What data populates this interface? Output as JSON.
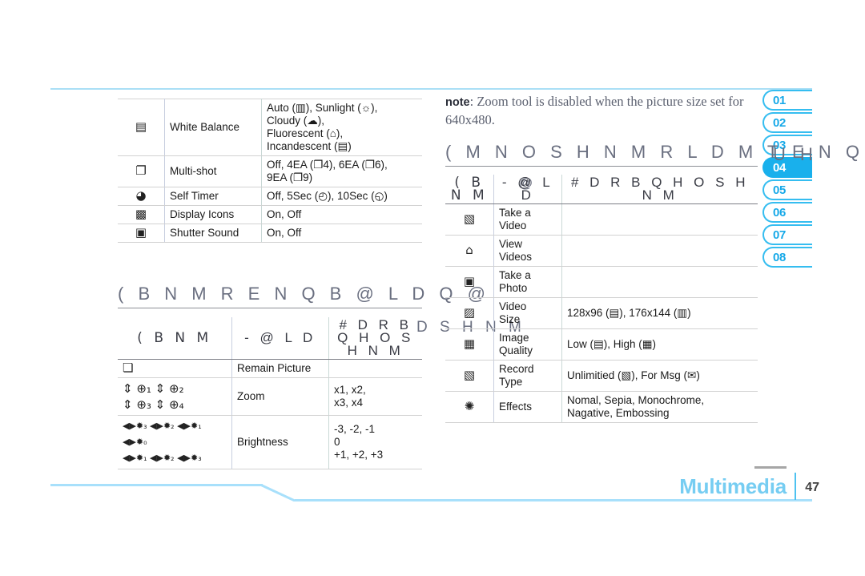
{
  "page": {
    "footer_title": "Multimedia",
    "footer_page_number": "47"
  },
  "tab_rail": {
    "items": [
      {
        "label": "01",
        "active": false
      },
      {
        "label": "02",
        "active": false
      },
      {
        "label": "03",
        "active": false
      },
      {
        "label": "04",
        "active": true
      },
      {
        "label": "05",
        "active": false
      },
      {
        "label": "06",
        "active": false
      },
      {
        "label": "07",
        "active": false
      },
      {
        "label": "08",
        "active": false
      }
    ]
  },
  "camera_settings_table": {
    "rows": [
      {
        "icon": "white-balance-icon",
        "icon_glyph": "▤",
        "name": "White Balance",
        "description": "Auto (▥), Sunlight (☼),\nCloudy (☁),\nFluorescent (⌂),\nIncandescent (▤)"
      },
      {
        "icon": "multi-shot-icon",
        "icon_glyph": "❐",
        "name": "Multi-shot",
        "description": "Off, 4EA (❐4), 6EA (❐6),\n9EA (❐9)"
      },
      {
        "icon": "self-timer-icon",
        "icon_glyph": "◕",
        "name": "Self Timer",
        "description": "Off, 5Sec (◴), 10Sec (◵)"
      },
      {
        "icon": "display-icons-icon",
        "icon_glyph": "▩",
        "name": "Display Icons",
        "description": "On, Off"
      },
      {
        "icon": "shutter-sound-icon",
        "icon_glyph": "▣",
        "name": "Shutter Sound",
        "description": "On, Off"
      }
    ]
  },
  "camera_icons_section": {
    "heading": "( B N M R  E N Q  B @ L D Q @",
    "columns": [
      "( B N M",
      "- @ L D",
      "# D R B Q H O S H N M"
    ],
    "rows": [
      {
        "icon": "remain-picture-icon",
        "icon_glyph": "❏",
        "name": "Remain Picture",
        "description": ""
      },
      {
        "icon": "zoom-level-icons",
        "icon_glyph": "⇕ ⊕₁ ⇕ ⊕₂\n⇕ ⊕₃ ⇕ ⊕₄",
        "name": "Zoom",
        "description": "x1, x2,\nx3, x4"
      },
      {
        "icon": "brightness-level-icons",
        "icon_glyph": "◀▶✹₃ ◀▶✹₂ ◀▶✹₁\n◀▶✹₀\n◀▶✹₁ ◀▶✹₂ ◀▶✹₃",
        "name": "Brightness",
        "description": "-3, -2, -1\n0\n+1, +2, +3"
      }
    ]
  },
  "note": {
    "label": "note",
    "text": ": Zoom tool is disabled when the picture size set for 640x480."
  },
  "video_options_section": {
    "heading": "( M  N O S H N M R  L D M T  E N Q  U H",
    "heading_bleed_right": "U H",
    "columns": [
      "( B N M",
      "- @ L D",
      "# D R B Q H O S H N M"
    ],
    "rows": [
      {
        "icon": "take-a-video-icon",
        "icon_glyph": "▧",
        "name": "Take a\nVideo",
        "description": ""
      },
      {
        "icon": "view-videos-icon",
        "icon_glyph": "⌂",
        "name": "View\nVideos",
        "description": ""
      },
      {
        "icon": "take-a-photo-icon",
        "icon_glyph": "▣",
        "name": "Take a\nPhoto",
        "description": ""
      },
      {
        "icon": "video-size-icon",
        "icon_glyph": "▨",
        "name": "Video\nSize",
        "description": "128x96 (▤), 176x144 (▥)"
      },
      {
        "icon": "image-quality-icon",
        "icon_glyph": "▦",
        "name": "Image\nQuality",
        "description": "Low (▤), High (▦)"
      },
      {
        "icon": "record-type-icon",
        "icon_glyph": "▧",
        "name": "Record\nType",
        "description": "Unlimitied (▧), For Msg (✉)"
      },
      {
        "icon": "effects-icon",
        "icon_glyph": "✺",
        "name": "Effects",
        "description": "Nomal, Sepia, Monochrome,\nNagative, Embossing"
      }
    ]
  },
  "bleed_artifacts": {
    "video_row_overlap": "D S H  N  M",
    "header_overlap": "@"
  },
  "colors": {
    "accent": "#19b0ec",
    "accent_light": "#a8e0fb",
    "tab_border": "#35bdf0",
    "footer_title": "#76cdf2",
    "text": "#1a1a1a",
    "heading": "#6a6f80"
  }
}
